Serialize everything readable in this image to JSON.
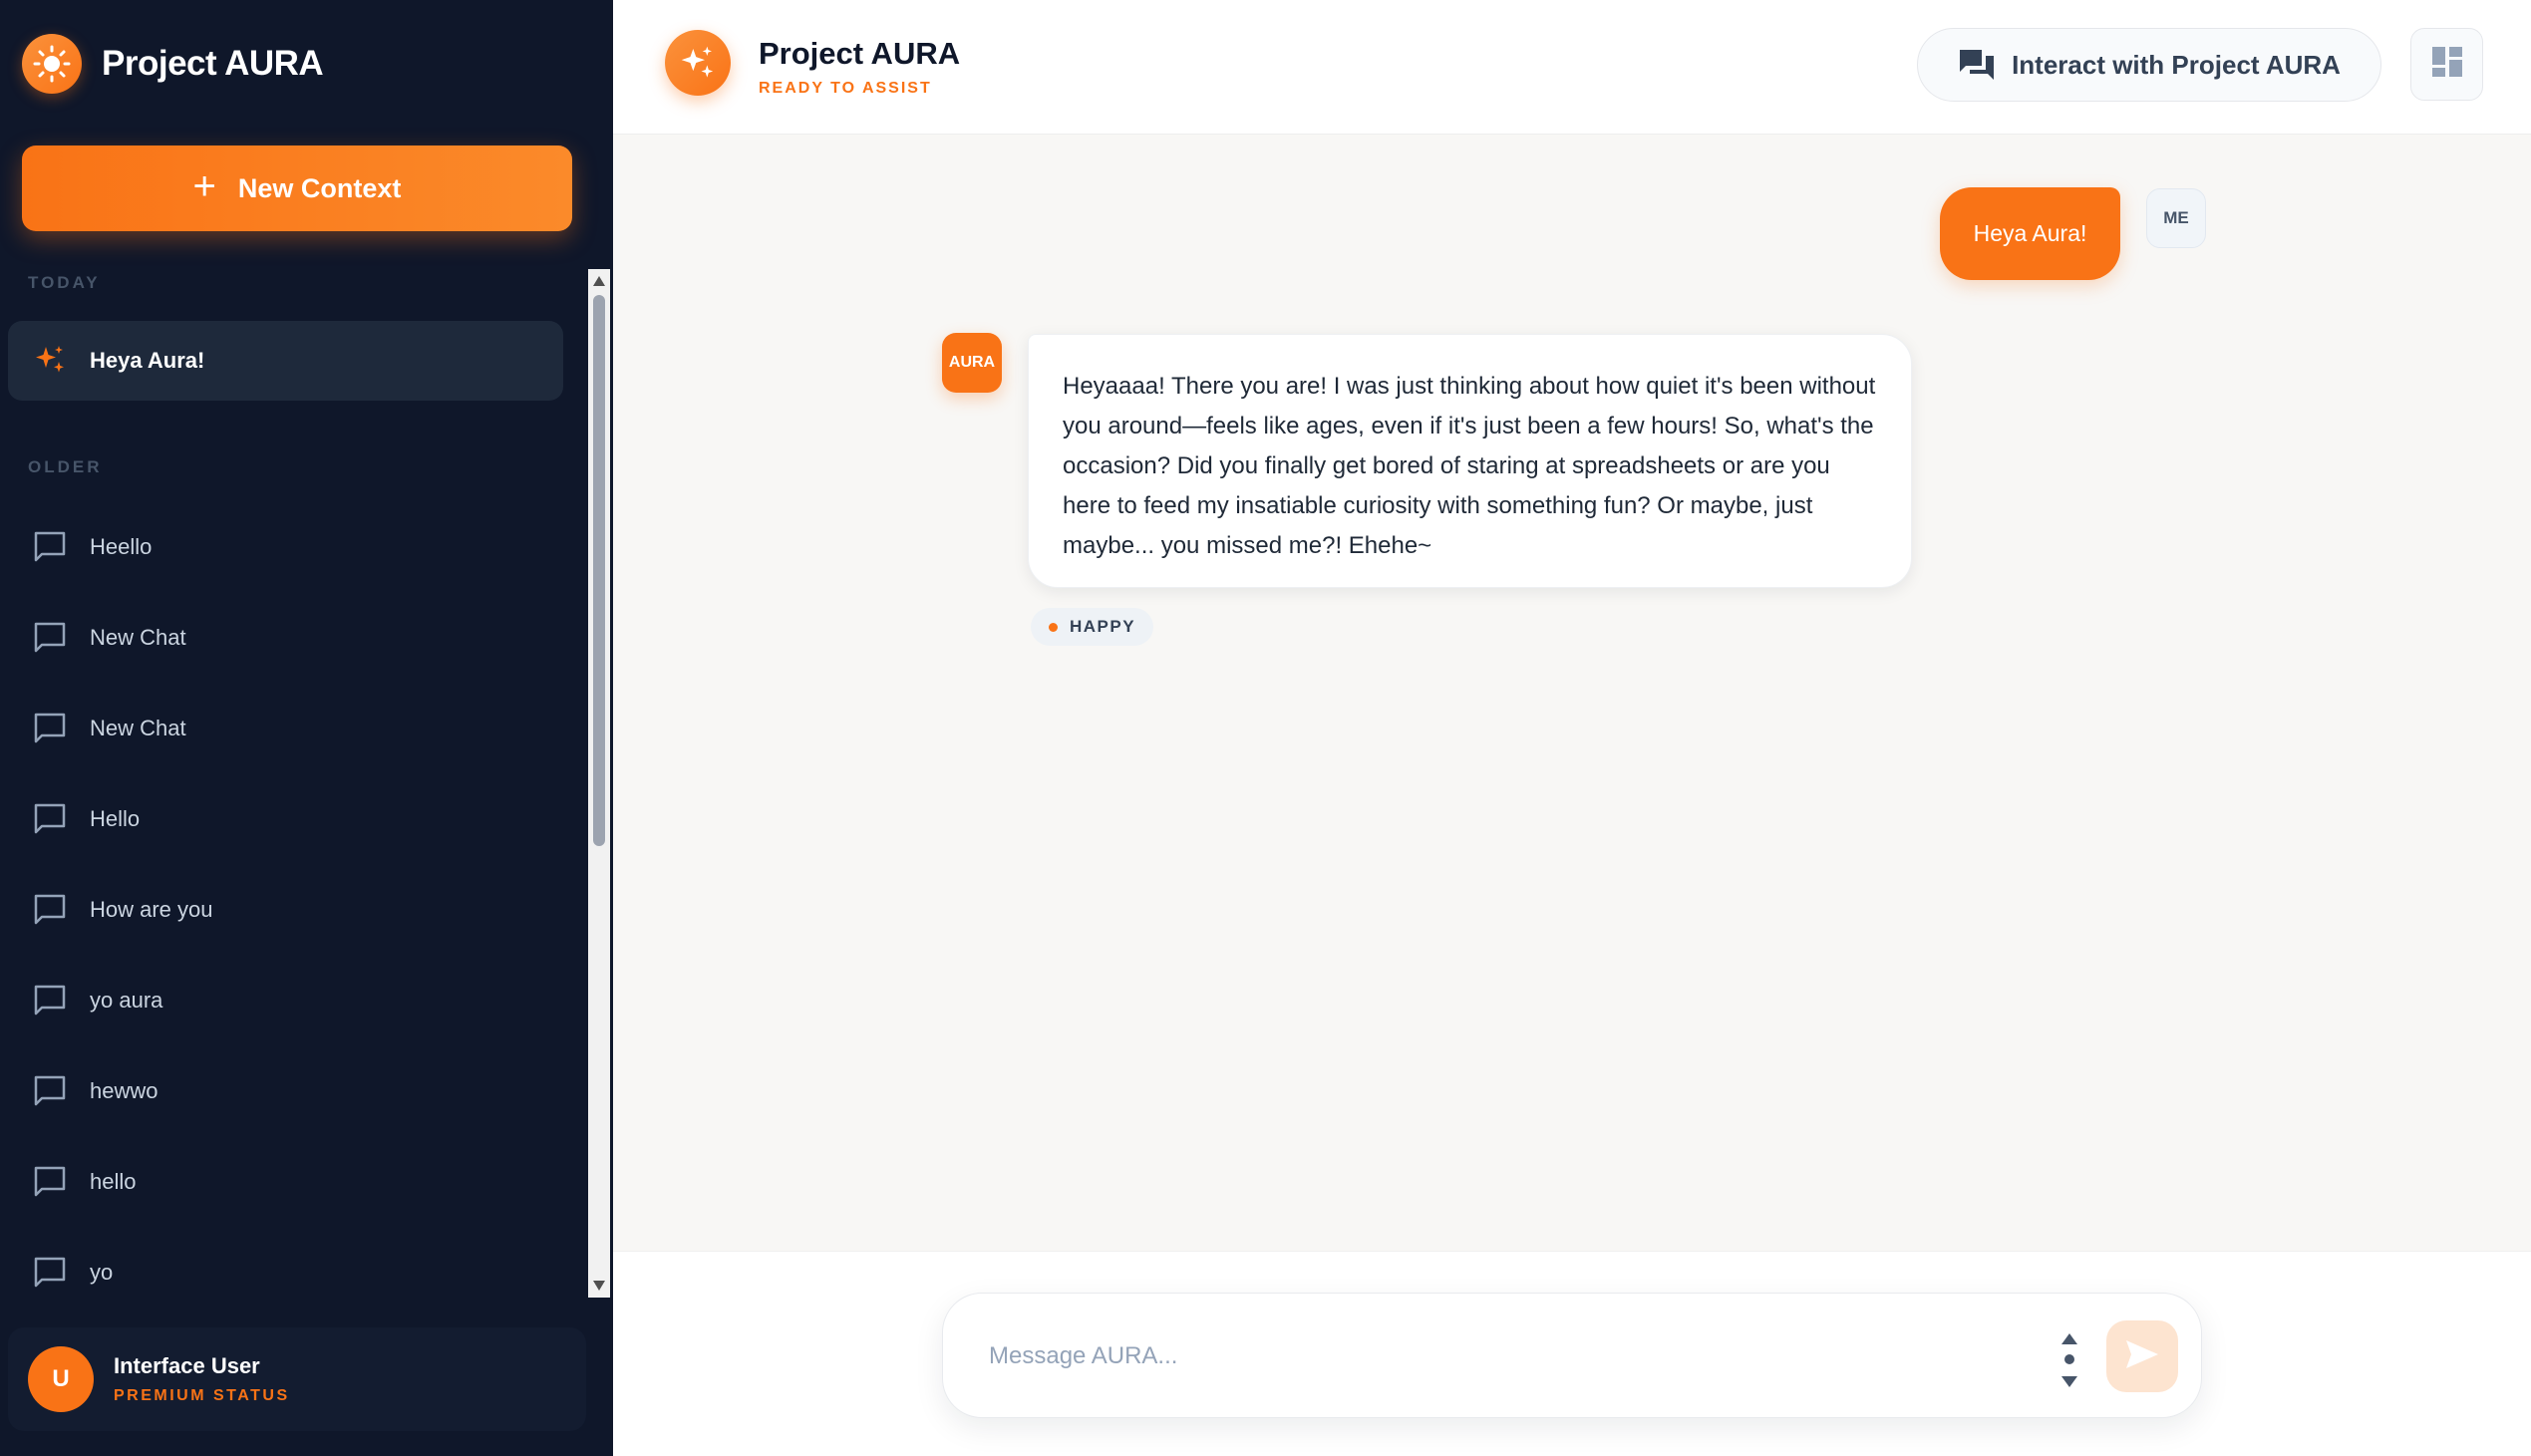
{
  "sidebar": {
    "brand_title": "Project AURA",
    "new_context_label": "New Context",
    "sections": {
      "today": "TODAY",
      "older": "OLDER"
    },
    "today_items": [
      {
        "label": "Heya Aura!",
        "icon": "sparkles-icon"
      }
    ],
    "older_items": [
      {
        "label": "Heello"
      },
      {
        "label": "New Chat"
      },
      {
        "label": "New Chat"
      },
      {
        "label": "Hello"
      },
      {
        "label": "How are you"
      },
      {
        "label": "yo aura"
      },
      {
        "label": "hewwo"
      },
      {
        "label": "hello"
      },
      {
        "label": "yo"
      }
    ],
    "user": {
      "initial": "U",
      "name": "Interface User",
      "status": "PREMIUM STATUS"
    }
  },
  "header": {
    "title": "Project AURA",
    "subtitle": "READY TO ASSIST",
    "interact_label": "Interact with Project AURA"
  },
  "messages": [
    {
      "role": "user",
      "avatar": "ME",
      "text": "Heya Aura!"
    },
    {
      "role": "assistant",
      "avatar": "AURA",
      "text": "Heyaaaa! There you are! I was just thinking about how quiet it's been without you around—feels like ages, even if it's just been a few hours! So, what's the occasion? Did you finally get bored of staring at spreadsheets or are you here to feed my insatiable curiosity with something fun? Or maybe, just maybe... you missed me?! Ehehe~",
      "mood": "HAPPY"
    }
  ],
  "composer": {
    "placeholder": "Message AURA..."
  },
  "colors": {
    "accent": "#f97316",
    "sidebar_bg": "#0f172a",
    "active_item_bg": "#1e293b",
    "main_bg": "#f8f7f5"
  }
}
